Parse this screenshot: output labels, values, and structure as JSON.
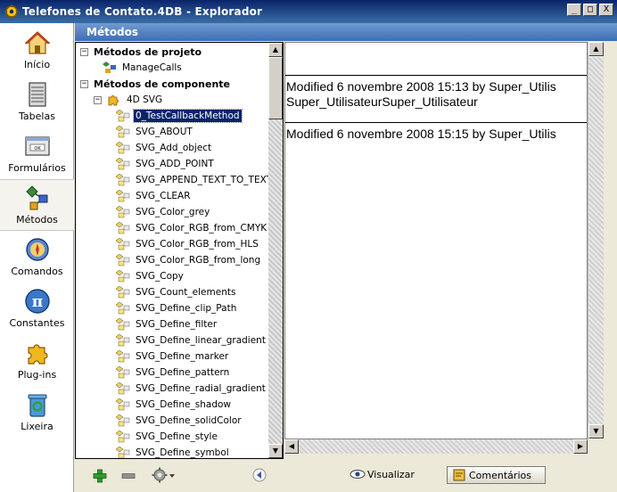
{
  "window": {
    "title": "Telefones de Contato.4DB - Explorador",
    "minimize": "_",
    "maximize": "□",
    "close": "X"
  },
  "sidebar": {
    "items": [
      {
        "label": "Início",
        "icon": "home-icon"
      },
      {
        "label": "Tabelas",
        "icon": "table-icon"
      },
      {
        "label": "Formulários",
        "icon": "form-icon"
      },
      {
        "label": "Métodos",
        "icon": "methods-icon",
        "active": true
      },
      {
        "label": "Comandos",
        "icon": "commands-icon"
      },
      {
        "label": "Constantes",
        "icon": "constants-pi-icon"
      },
      {
        "label": "Plug-ins",
        "icon": "plugin-puzzle-icon"
      },
      {
        "label": "Lixeira",
        "icon": "trash-icon"
      }
    ]
  },
  "header": {
    "title": "Métodos"
  },
  "tree": {
    "project_group": "Métodos de projeto",
    "project_items": [
      "ManageCalls"
    ],
    "component_group": "Métodos de componente",
    "component_name": "4D SVG",
    "selected": "0_TestCallbackMethod",
    "methods": [
      "0_TestCallbackMethod",
      "SVG_ABOUT",
      "SVG_Add_object",
      "SVG_ADD_POINT",
      "SVG_APPEND_TEXT_TO_TEXTA",
      "SVG_CLEAR",
      "SVG_Color_grey",
      "SVG_Color_RGB_from_CMYK",
      "SVG_Color_RGB_from_HLS",
      "SVG_Color_RGB_from_long",
      "SVG_Copy",
      "SVG_Count_elements",
      "SVG_Define_clip_Path",
      "SVG_Define_filter",
      "SVG_Define_linear_gradient",
      "SVG_Define_marker",
      "SVG_Define_pattern",
      "SVG_Define_radial_gradient",
      "SVG_Define_shadow",
      "SVG_Define_solidColor",
      "SVG_Define_style",
      "SVG_Define_symbol"
    ],
    "expanded_glyph": "−"
  },
  "details": {
    "modified_1": "Modified 6 novembre 2008 15:13 by Super_Utilis",
    "author_line": "Super_UtilisateurSuper_Utilisateur",
    "modified_2": "Modified 6 novembre 2008 15:15 by Super_Utilis"
  },
  "bottombar": {
    "visualizar": "Visualizar",
    "comentarios": "Comentários"
  },
  "colors": {
    "title_bar": "#0a246a",
    "header_bar": "#3d6db5",
    "selection": "#0a246a"
  }
}
